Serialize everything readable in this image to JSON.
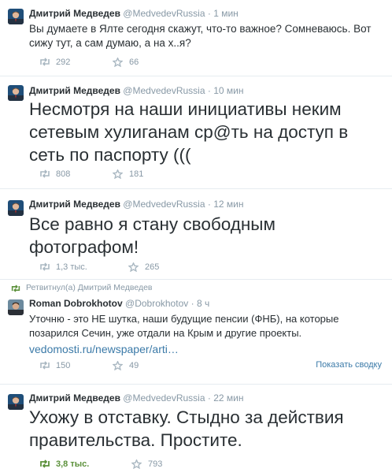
{
  "tweets": [
    {
      "name": "Дмитрий Медведев",
      "handle": "@MedvedevRussia",
      "dot": "·",
      "time": "1 мин",
      "text": "Вы думаете в Ялте сегодня скажут, что-то важное? Сомневаюсь. Вот сижу тут, а сам думаю, а на х..я?",
      "retweets": "292",
      "favorites": "66"
    },
    {
      "name": "Дмитрий Медведев",
      "handle": "@MedvedevRussia",
      "dot": "·",
      "time": "10 мин",
      "text": "Несмотря на наши инициативы неким сетевым хулиганам ср@ть на доступ в сеть по паспорту (((",
      "retweets": "808",
      "favorites": "181"
    },
    {
      "name": "Дмитрий Медведев",
      "handle": "@MedvedevRussia",
      "dot": "·",
      "time": "12 мин",
      "text": "Все равно я стану свободным фотографом!",
      "retweets": "1,3 тыс.",
      "favorites": "265"
    },
    {
      "retweet_note": "Ретвитнул(а) Дмитрий Медведев",
      "name": "Roman Dobrokhotov",
      "handle": "@Dobrokhotov",
      "dot": "·",
      "time": "8 ч",
      "text": "Уточню - это НЕ шутка, наши будущие пенсии (ФНБ), на которые позарился Сечин, уже отдали на Крым и другие проекты.",
      "link": "vedomosti.ru/newspaper/arti…",
      "retweets": "150",
      "favorites": "49",
      "summary_label": "Показать сводку"
    },
    {
      "name": "Дмитрий Медведев",
      "handle": "@MedvedevRussia",
      "dot": "·",
      "time": "22 мин",
      "text": "Ухожу в отставку. Стыдно за действия правительства. Простите.",
      "retweets": "3,8 тыс.",
      "favorites": "793"
    }
  ],
  "icons": {
    "avatar": "avatar",
    "retweet": "retweet-icon",
    "favorite": "star-icon"
  },
  "colors": {
    "text": "#292f33",
    "meta": "#8899a6",
    "link": "#3b7aa8",
    "retweet_active": "#5c913b"
  }
}
